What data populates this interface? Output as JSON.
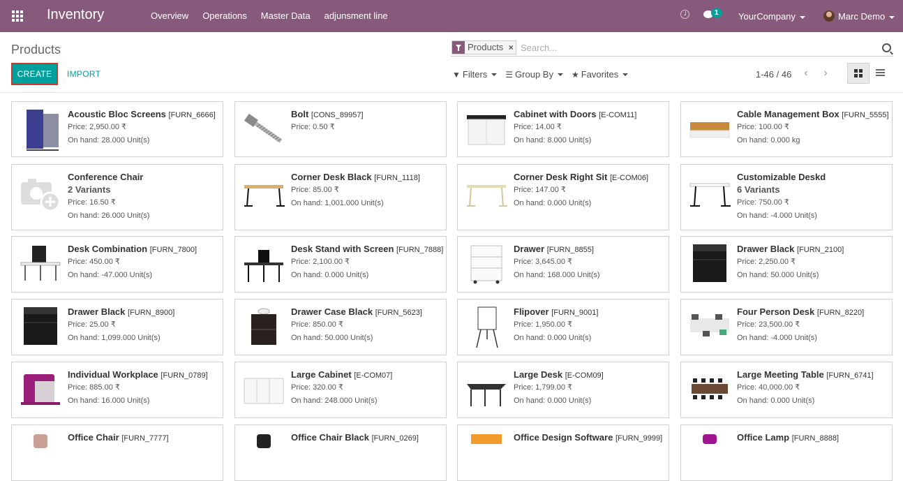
{
  "navbar": {
    "brand": "Inventory",
    "menu": [
      "Overview",
      "Operations",
      "Master Data",
      "adjunsment line"
    ],
    "message_count": "1",
    "company": "YourCompany",
    "user": "Marc Demo",
    "bg_color": "#875a7b"
  },
  "control_panel": {
    "title": "Products",
    "create_label": "CREATE",
    "import_label": "IMPORT",
    "search_facet": "Products",
    "search_placeholder": "Search...",
    "filters_label": "Filters",
    "groupby_label": "Group By",
    "favorites_label": "Favorites",
    "pager": "1-46 / 46",
    "accent_color": "#00a09d"
  },
  "products": [
    {
      "name": "Acoustic Bloc Screens",
      "ref": "[FURN_6666]",
      "variants": "",
      "price": "Price: 2,950.00 ₹",
      "onhand": "On hand: 28.000 Unit(s)",
      "icon": "acoustic-screen"
    },
    {
      "name": "Bolt",
      "ref": "[CONS_89957]",
      "variants": "",
      "price": "Price: 0.50 ₹",
      "onhand": "",
      "icon": "bolt"
    },
    {
      "name": "Cabinet with Doors",
      "ref": "[E-COM11]",
      "variants": "",
      "price": "Price: 14.00 ₹",
      "onhand": "On hand: 8.000 Unit(s)",
      "icon": "cabinet"
    },
    {
      "name": "Cable Management Box",
      "ref": "[FURN_5555]",
      "variants": "",
      "price": "Price: 100.00 ₹",
      "onhand": "On hand: 0.000 kg",
      "icon": "cable-box"
    },
    {
      "name": "Conference Chair",
      "ref": "",
      "variants": "2 Variants",
      "price": "Price: 16.50 ₹",
      "onhand": "On hand: 26.000 Unit(s)",
      "icon": "placeholder-camera"
    },
    {
      "name": "Corner Desk Black",
      "ref": "[FURN_1118]",
      "variants": "",
      "price": "Price: 85.00 ₹",
      "onhand": "On hand: 1,001.000 Unit(s)",
      "icon": "desk-black"
    },
    {
      "name": "Corner Desk Right Sit",
      "ref": "[E-COM06]",
      "variants": "",
      "price": "Price: 147.00 ₹",
      "onhand": "On hand: 0.000 Unit(s)",
      "icon": "desk-light"
    },
    {
      "name": "Customizable Deskd",
      "ref": "",
      "variants": "6 Variants",
      "price": "Price: 750.00 ₹",
      "onhand": "On hand: -4.000 Unit(s)",
      "icon": "desk-white"
    },
    {
      "name": "Desk Combination",
      "ref": "[FURN_7800]",
      "variants": "",
      "price": "Price: 450.00 ₹",
      "onhand": "On hand: -47.000 Unit(s)",
      "icon": "desk-combo"
    },
    {
      "name": "Desk Stand with Screen",
      "ref": "[FURN_7888]",
      "variants": "",
      "price": "Price: 2,100.00 ₹",
      "onhand": "On hand: 0.000 Unit(s)",
      "icon": "desk-screen"
    },
    {
      "name": "Drawer",
      "ref": "[FURN_8855]",
      "variants": "",
      "price": "Price: 3,645.00 ₹",
      "onhand": "On hand: 168.000 Unit(s)",
      "icon": "drawer-white"
    },
    {
      "name": "Drawer Black",
      "ref": "[FURN_2100]",
      "variants": "",
      "price": "Price: 2,250.00 ₹",
      "onhand": "On hand: 50.000 Unit(s)",
      "icon": "drawer-black"
    },
    {
      "name": "Drawer Black",
      "ref": "[FURN_8900]",
      "variants": "",
      "price": "Price: 25.00 ₹",
      "onhand": "On hand: 1,099.000 Unit(s)",
      "icon": "drawer-black"
    },
    {
      "name": "Drawer Case Black",
      "ref": "[FURN_5623]",
      "variants": "",
      "price": "Price: 850.00 ₹",
      "onhand": "On hand: 50.000 Unit(s)",
      "icon": "drawer-case"
    },
    {
      "name": "Flipover",
      "ref": "[FURN_9001]",
      "variants": "",
      "price": "Price: 1,950.00 ₹",
      "onhand": "On hand: 0.000 Unit(s)",
      "icon": "flipover"
    },
    {
      "name": "Four Person Desk",
      "ref": "[FURN_8220]",
      "variants": "",
      "price": "Price: 23,500.00 ₹",
      "onhand": "On hand: -4.000 Unit(s)",
      "icon": "four-desk"
    },
    {
      "name": "Individual Workplace",
      "ref": "[FURN_0789]",
      "variants": "",
      "price": "Price: 885.00 ₹",
      "onhand": "On hand: 16.000 Unit(s)",
      "icon": "workplace"
    },
    {
      "name": "Large Cabinet",
      "ref": "[E-COM07]",
      "variants": "",
      "price": "Price: 320.00 ₹",
      "onhand": "On hand: 248.000 Unit(s)",
      "icon": "large-cabinet"
    },
    {
      "name": "Large Desk",
      "ref": "[E-COM09]",
      "variants": "",
      "price": "Price: 1,799.00 ₹",
      "onhand": "On hand: 0.000 Unit(s)",
      "icon": "large-desk"
    },
    {
      "name": "Large Meeting Table",
      "ref": "[FURN_6741]",
      "variants": "",
      "price": "Price: 40,000.00 ₹",
      "onhand": "On hand: 0.000 Unit(s)",
      "icon": "meeting-table"
    },
    {
      "name": "Office Chair",
      "ref": "[FURN_7777]",
      "variants": "",
      "price": "",
      "onhand": "",
      "icon": "chair"
    },
    {
      "name": "Office Chair Black",
      "ref": "[FURN_0269]",
      "variants": "",
      "price": "",
      "onhand": "",
      "icon": "chair-black"
    },
    {
      "name": "Office Design Software",
      "ref": "[FURN_9999]",
      "variants": "",
      "price": "",
      "onhand": "",
      "icon": "software"
    },
    {
      "name": "Office Lamp",
      "ref": "[FURN_8888]",
      "variants": "",
      "price": "",
      "onhand": "",
      "icon": "lamp"
    }
  ]
}
